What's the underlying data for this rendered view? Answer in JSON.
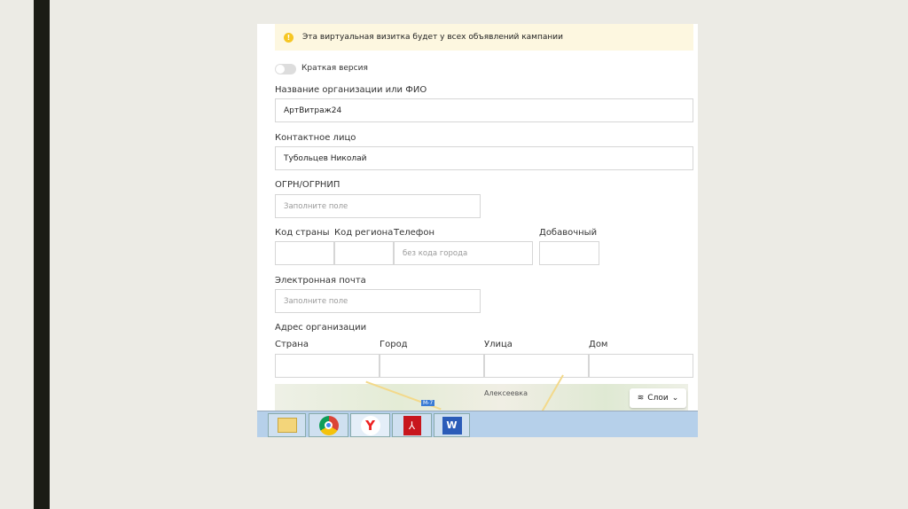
{
  "notice": "Эта виртуальная визитка будет у всех объявлений кампании",
  "toggle_label": "Краткая версия",
  "org": {
    "label": "Название организации или ФИО",
    "value": "АртВитраж24"
  },
  "contact": {
    "label": "Контактное лицо",
    "value": "Тубольцев Николай"
  },
  "ogrn": {
    "label": "ОГРН/ОГРНИП",
    "placeholder": "Заполните поле"
  },
  "phone": {
    "country_label": "Код страны",
    "region_label": "Код региона",
    "phone_label": "Телефон",
    "phone_placeholder": "без кода города",
    "ext_label": "Добавочный"
  },
  "email": {
    "label": "Электронная почта",
    "placeholder": "Заполните поле"
  },
  "address": {
    "label": "Адрес организации",
    "country": "Страна",
    "city": "Город",
    "street": "Улица",
    "house": "Дом"
  },
  "map": {
    "place": "Алексеевка",
    "road": "М-7",
    "layers": "Слои"
  },
  "taskbar": [
    "File Explorer",
    "Chrome",
    "Yandex",
    "Acrobat",
    "Word"
  ]
}
